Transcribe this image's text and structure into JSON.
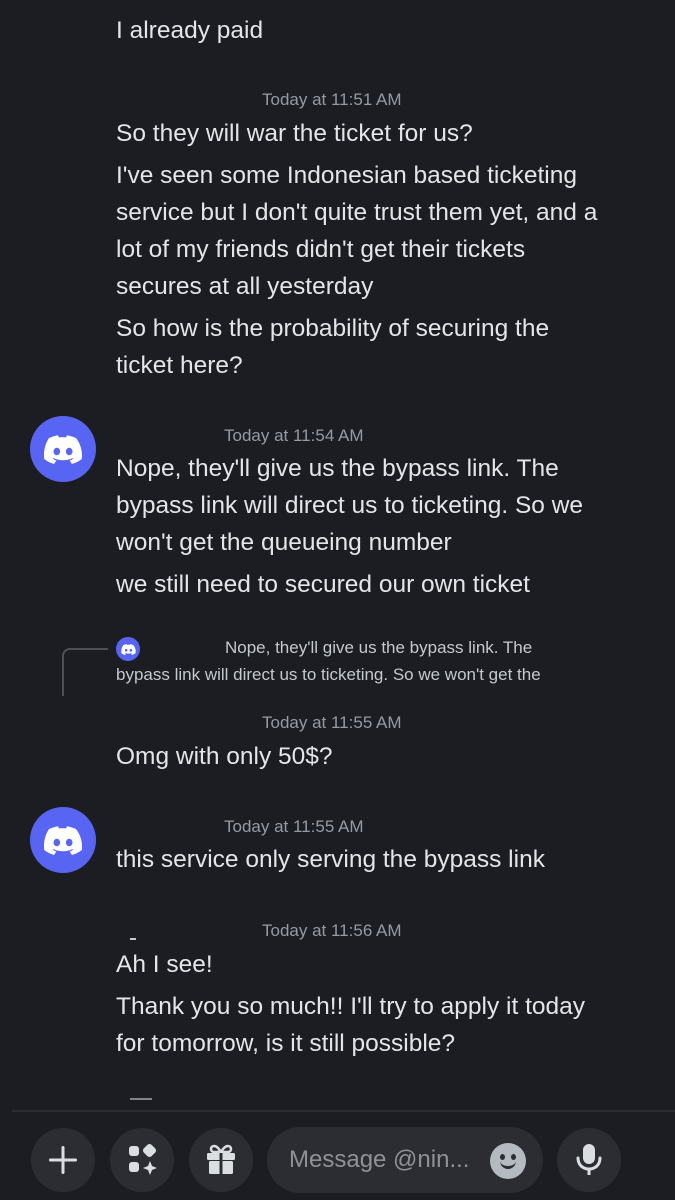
{
  "messages": {
    "m0": {
      "lines": [
        "I already paid"
      ]
    },
    "m1": {
      "timestamp": "Today at 11:51 AM",
      "lines": [
        "So they will war the ticket for us?",
        "I've seen some Indonesian based ticketing",
        "service but I don't quite trust them yet, and a",
        "lot of my friends didn't get their tickets",
        "secures at all yesterday",
        "So how is the probability of securing the",
        "ticket here?"
      ]
    },
    "m2": {
      "timestamp": "Today at 11:54 AM",
      "lines": [
        "Nope, they'll give us the bypass link. The",
        "bypass link will direct us to ticketing. So we",
        "won't get the queueing number",
        "we still need to secured our own ticket"
      ]
    },
    "reply": {
      "lines": [
        "Nope, they'll give us the bypass link. The",
        "bypass link will direct us to ticketing. So we won't get the"
      ]
    },
    "m3": {
      "timestamp": "Today at 11:55 AM",
      "lines": [
        "Omg with only 50$?"
      ]
    },
    "m4": {
      "timestamp": "Today at 11:55 AM",
      "lines": [
        "this service only serving the bypass link"
      ]
    },
    "m5": {
      "timestamp": "Today at 11:56 AM",
      "lines": [
        "Ah I see!",
        "Thank you so much!! I'll try to apply it today",
        "for tomorrow, is it still possible?"
      ]
    }
  },
  "composer": {
    "placeholder": "Message @nin..."
  },
  "colors": {
    "background": "#1c1d22",
    "accent": "#5865f2",
    "button_bg": "#2b2d33",
    "timestamp": "#949ba4",
    "text": "#e3e5e8"
  },
  "icons": {
    "avatar": "discord-logo-icon",
    "add": "plus-icon",
    "apps": "apps-sparkle-icon",
    "gift": "gift-icon",
    "emoji": "emoji-icon",
    "voice": "microphone-icon"
  }
}
